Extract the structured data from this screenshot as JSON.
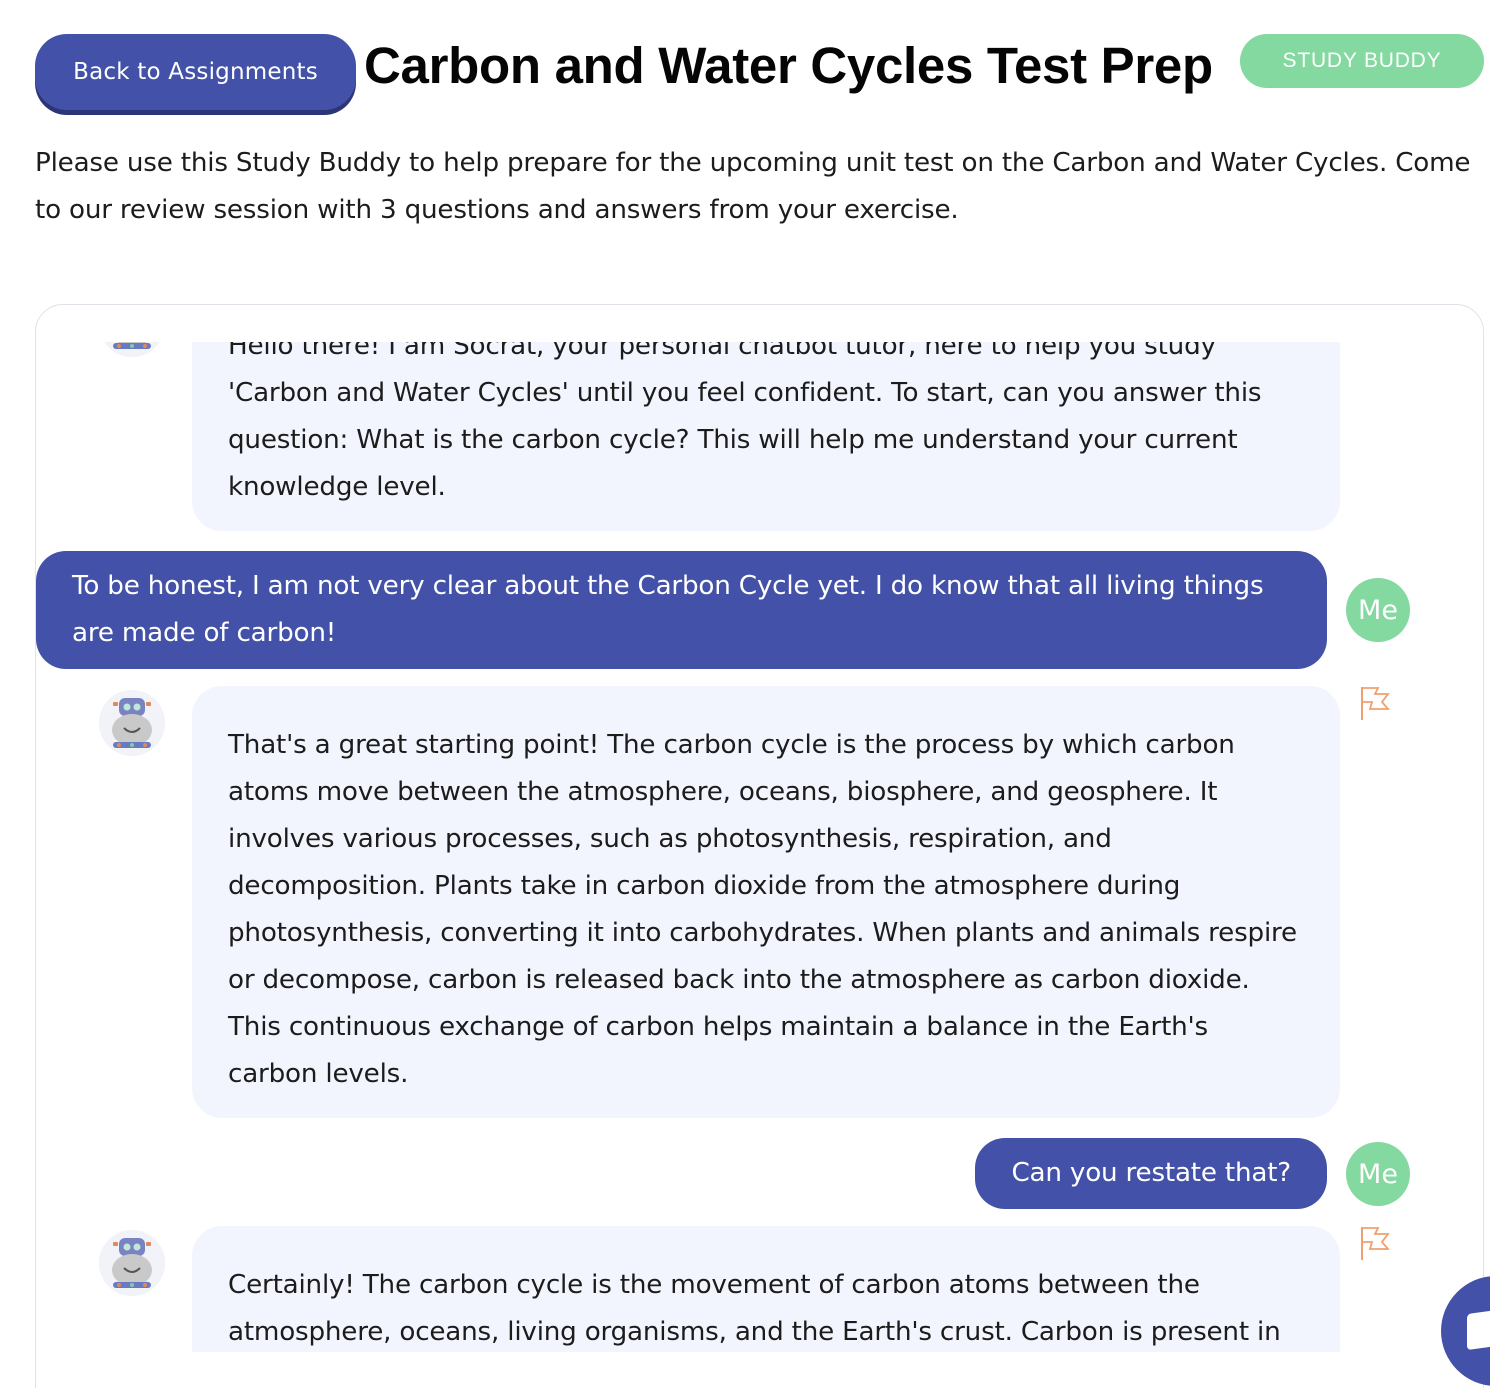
{
  "header": {
    "back_label": "Back to Assignments",
    "title": "Carbon and Water Cycles Test Prep",
    "badge": "STUDY BUDDY"
  },
  "description": "Please use this Study Buddy to help prepare for the upcoming unit test on the Carbon and Water Cycles. Come to our review session with 3 questions and answers from your exercise.",
  "chat": {
    "messages": [
      {
        "role": "bot",
        "avatar_icon": "robot-avatar-icon",
        "flag_icon": "flag-icon",
        "text": "Hello there! I am Socrat, your personal chatbot tutor, here to help you study 'Carbon and Water Cycles' until you feel confident. To start, can you answer this question: What is the carbon cycle? This will help me understand your current knowledge level."
      },
      {
        "role": "user",
        "avatar_label": "Me",
        "text": "To be honest, I am not very clear about the Carbon Cycle yet. I do know that all living things are made of carbon!"
      },
      {
        "role": "bot",
        "avatar_icon": "robot-avatar-icon",
        "flag_icon": "flag-icon",
        "text": "That's a great starting point! The carbon cycle is the process by which carbon atoms move between the atmosphere, oceans, biosphere, and geosphere. It involves various processes, such as photosynthesis, respiration, and decomposition. Plants take in carbon dioxide from the atmosphere during photosynthesis, converting it into carbohydrates. When plants and animals respire or decompose, carbon is released back into the atmosphere as carbon dioxide. This continuous exchange of carbon helps maintain a balance in the Earth's carbon levels."
      },
      {
        "role": "user",
        "avatar_label": "Me",
        "text": "Can you restate that?"
      },
      {
        "role": "bot",
        "avatar_icon": "robot-avatar-icon",
        "flag_icon": "flag-icon",
        "text": "Certainly! The carbon cycle is the movement of carbon atoms between the atmosphere, oceans, living organisms, and the Earth's crust. Carbon is present in all living things and is constantly being exchanged. During photosynthesis,"
      }
    ]
  },
  "help_icon": "chat-help-icon",
  "colors": {
    "primary": "#4352a8",
    "accent_green": "#84d9a0",
    "bot_bubble": "#f2f5fd",
    "flag": "#f0a070"
  }
}
